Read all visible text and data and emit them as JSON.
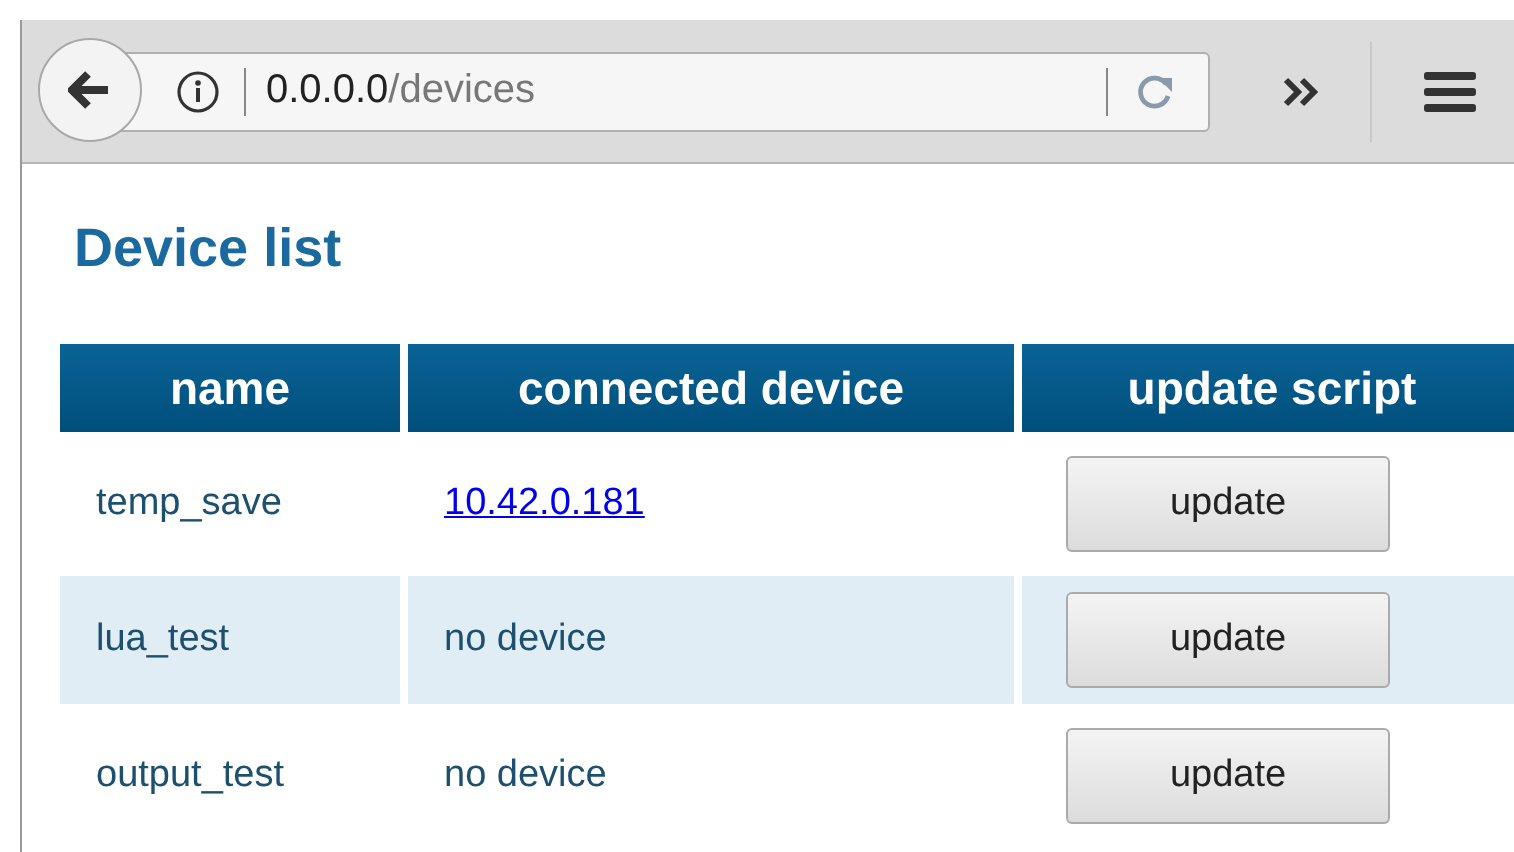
{
  "browser": {
    "url_host": "0.0.0.0",
    "url_path": "/devices"
  },
  "page": {
    "title": "Device list"
  },
  "table": {
    "columns": [
      "name",
      "connected device",
      "update script"
    ],
    "rows": [
      {
        "name": "temp_save",
        "device": {
          "kind": "link",
          "text": "10.42.0.181"
        },
        "button": "update"
      },
      {
        "name": "lua_test",
        "device": {
          "kind": "text",
          "text": "no device"
        },
        "button": "update"
      },
      {
        "name": "output_test",
        "device": {
          "kind": "text",
          "text": "no device"
        },
        "button": "update"
      }
    ]
  }
}
